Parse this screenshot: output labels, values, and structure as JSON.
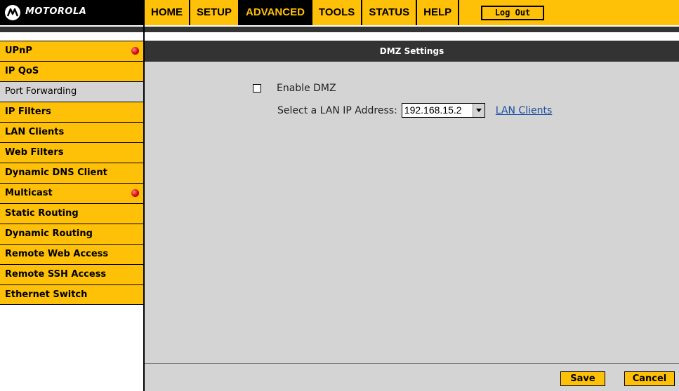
{
  "brand": {
    "logo_text": "MOTOROLA",
    "accent_color": "#ffc107"
  },
  "nav": {
    "items": [
      "HOME",
      "SETUP",
      "ADVANCED",
      "TOOLS",
      "STATUS",
      "HELP"
    ],
    "active": "ADVANCED",
    "logout_label": "Log Out"
  },
  "sidebar": {
    "items": [
      {
        "label": "UPnP",
        "badge": "red-dot-icon"
      },
      {
        "label": "IP QoS"
      },
      {
        "label": "Port Forwarding",
        "selected": true
      },
      {
        "label": "IP Filters"
      },
      {
        "label": "LAN Clients"
      },
      {
        "label": "Web Filters"
      },
      {
        "label": "Dynamic DNS Client"
      },
      {
        "label": "Multicast",
        "badge": "red-dot-icon"
      },
      {
        "label": "Static Routing"
      },
      {
        "label": "Dynamic Routing"
      },
      {
        "label": "Remote Web Access"
      },
      {
        "label": "Remote SSH Access"
      },
      {
        "label": "Ethernet Switch"
      }
    ]
  },
  "panel": {
    "title": "DMZ Settings",
    "enable_label": "Enable DMZ",
    "enable_checked": false,
    "ip_label": "Select a LAN IP Address:",
    "ip_value": "192.168.15.2",
    "lan_clients_link": "LAN Clients"
  },
  "footer": {
    "save_label": "Save",
    "cancel_label": "Cancel"
  }
}
